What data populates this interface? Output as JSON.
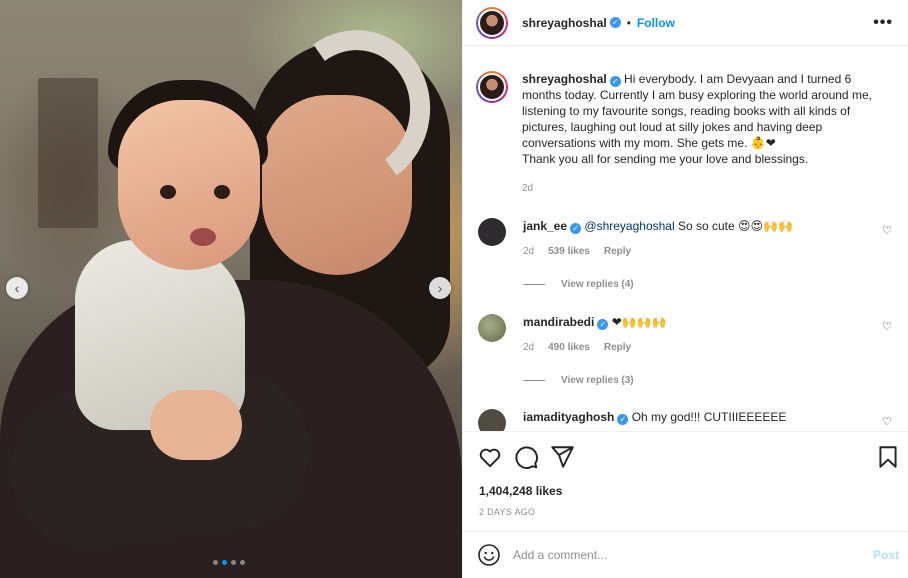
{
  "post": {
    "username": "shreyaghoshal",
    "verified_icon": "verified-badge-icon",
    "follow_label": "Follow",
    "separator": "•",
    "more_label": "•••"
  },
  "caption": {
    "username": "shreyaghoshal",
    "text": "Hi everybody. I am Devyaan and I turned 6 months today. Currently I am busy exploring the world around me, listening to my favourite songs, reading books with all kinds of pictures, laughing out loud at silly jokes and having deep conversations with my mom. She gets me. 👶❤\nThank you all for sending me your love and blessings.",
    "time": "2d"
  },
  "comments": [
    {
      "username": "jank_ee",
      "mention": "@shreyaghoshal",
      "text": " So so cute 😍😍🙌🙌",
      "time": "2d",
      "likes": "539 likes",
      "reply_label": "Reply",
      "view_replies": "View replies (4)",
      "avatar_color": "#2f2a2e"
    },
    {
      "username": "mandirabedi",
      "mention": "",
      "text": " ❤🙌🙌🙌",
      "time": "2d",
      "likes": "490 likes",
      "reply_label": "Reply",
      "view_replies": "View replies (3)",
      "avatar_color": "#7d8a64"
    },
    {
      "username": "iamadityaghosh",
      "mention": "",
      "text": " Oh my god!!! CUTIIIEEEEEE",
      "avatar_color": "#4f4a42"
    }
  ],
  "actions": {
    "like_icon": "heart-icon",
    "comment_icon": "comment-icon",
    "share_icon": "share-icon",
    "save_icon": "bookmark-icon",
    "likes_count": "1,404,248 likes",
    "ago": "2 DAYS AGO"
  },
  "composer": {
    "placeholder": "Add a comment...",
    "post_label": "Post"
  },
  "carousel": {
    "prev": "‹",
    "next": "›",
    "total_slides": 4,
    "current_slide": 2
  },
  "colors": {
    "accent": "#0095f6",
    "verified": "#3897f0",
    "muted": "#8e8e8e",
    "post_disabled": "#b2dffc"
  }
}
